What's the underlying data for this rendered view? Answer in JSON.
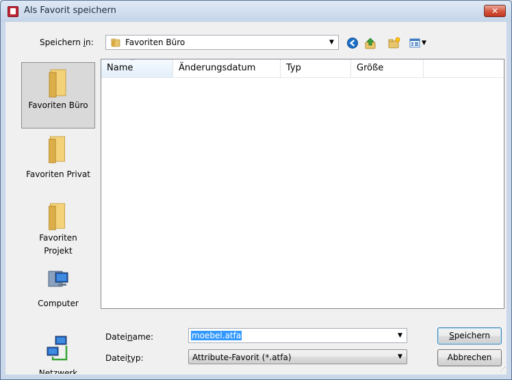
{
  "window": {
    "title": "Als Favorit speichern",
    "close_glyph": "✕"
  },
  "location": {
    "label_pre": "Speichern ",
    "label_u": "i",
    "label_post": "n:",
    "value": "Favoriten Büro"
  },
  "toolbar": {
    "icons": [
      "back-icon",
      "up-folder-icon",
      "new-folder-icon",
      "views-menu-icon"
    ]
  },
  "places": [
    {
      "label": "Favoriten Büro",
      "icon": "folder-icon",
      "selected": true
    },
    {
      "label": "Favoriten Privat",
      "icon": "folder-icon",
      "selected": false
    },
    {
      "label_line1": "Favoriten",
      "label_line2": "Projekt",
      "icon": "folder-icon",
      "selected": false
    },
    {
      "label": "Computer",
      "icon": "computer-icon",
      "selected": false
    },
    {
      "label": "Netzwerk",
      "icon": "network-icon",
      "selected": false
    }
  ],
  "columns": [
    {
      "label": "Name",
      "sorted": true
    },
    {
      "label": "Änderungsdatum"
    },
    {
      "label": "Typ"
    },
    {
      "label": "Größe"
    }
  ],
  "filename": {
    "label_pre": "Datei",
    "label_u": "n",
    "label_post": "ame:",
    "value": "moebel.atfa"
  },
  "filetype": {
    "label_pre": "Datei",
    "label_u": "t",
    "label_post": "yp:",
    "value": "Attribute-Favorit (*.atfa)"
  },
  "buttons": {
    "save_u": "S",
    "save_rest": "peichern",
    "cancel": "Abbrechen"
  },
  "colors": {
    "selection": "#3399ff",
    "title_bg": "#c4d4e8",
    "close_red": "#c2361f"
  }
}
